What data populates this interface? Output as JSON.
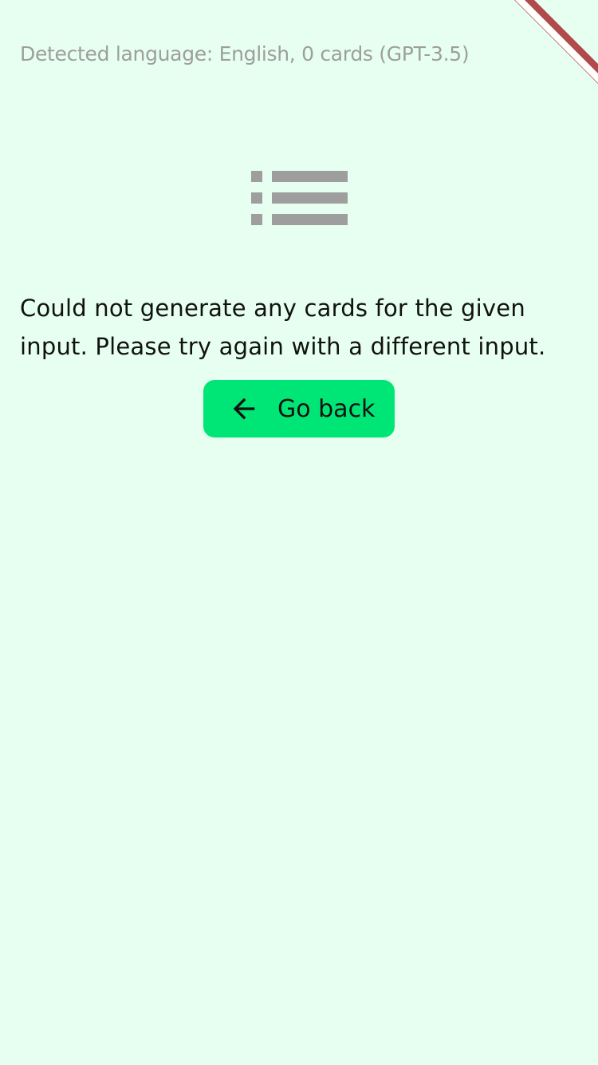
{
  "header": {
    "status": "Detected language: English, 0 cards (GPT-3.5)"
  },
  "empty_state": {
    "icon": "list-icon",
    "message": "Could not generate any cards for the given input. Please try again with a different input."
  },
  "actions": {
    "go_back_label": "Go back",
    "go_back_icon": "arrow-left-icon"
  },
  "colors": {
    "background": "#e6fff0",
    "accent": "#00e676",
    "icon_gray": "#9e9e9e",
    "status_text": "#9e9e9e",
    "text": "#111111",
    "debug_ribbon": "#b14a4a"
  }
}
